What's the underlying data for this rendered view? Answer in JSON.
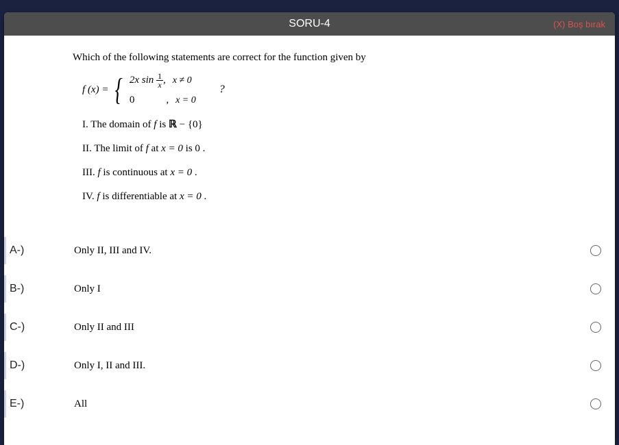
{
  "header": {
    "title": "SORU-4",
    "leave_label": "(X) Boş bırak"
  },
  "question": {
    "prompt": "Which of the following statements are correct for the function given by",
    "fx_label": "f (x) =",
    "case1_expr_prefix": "2x sin",
    "case1_frac_num": "1",
    "case1_frac_den": "x",
    "case1_cond": "x ≠ 0",
    "case2_expr": "0",
    "case2_cond": "x = 0",
    "qmark": "?",
    "stmt1_pre": "I. The domain of ",
    "stmt1_f": "f",
    "stmt1_mid": " is ",
    "stmt1_R": "ℝ",
    "stmt1_post": " − {0}",
    "stmt2_pre": "II. The limit of ",
    "stmt2_f": "f",
    "stmt2_mid": " at ",
    "stmt2_cond": "x = 0",
    "stmt2_post": " is 0 .",
    "stmt3_pre": "III. ",
    "stmt3_f": "f",
    "stmt3_mid": " is continuous at ",
    "stmt3_cond": "x = 0",
    "stmt3_post": " .",
    "stmt4_pre": "IV. ",
    "stmt4_f": "f",
    "stmt4_mid": " is differentiable at ",
    "stmt4_cond": "x = 0",
    "stmt4_post": " ."
  },
  "options": [
    {
      "letter": "A-)",
      "text": "Only II, III and IV."
    },
    {
      "letter": "B-)",
      "text": "Only I"
    },
    {
      "letter": "C-)",
      "text": "Only II and III"
    },
    {
      "letter": "D-)",
      "text": "Only I, II and III."
    },
    {
      "letter": "E-)",
      "text": "All"
    }
  ]
}
